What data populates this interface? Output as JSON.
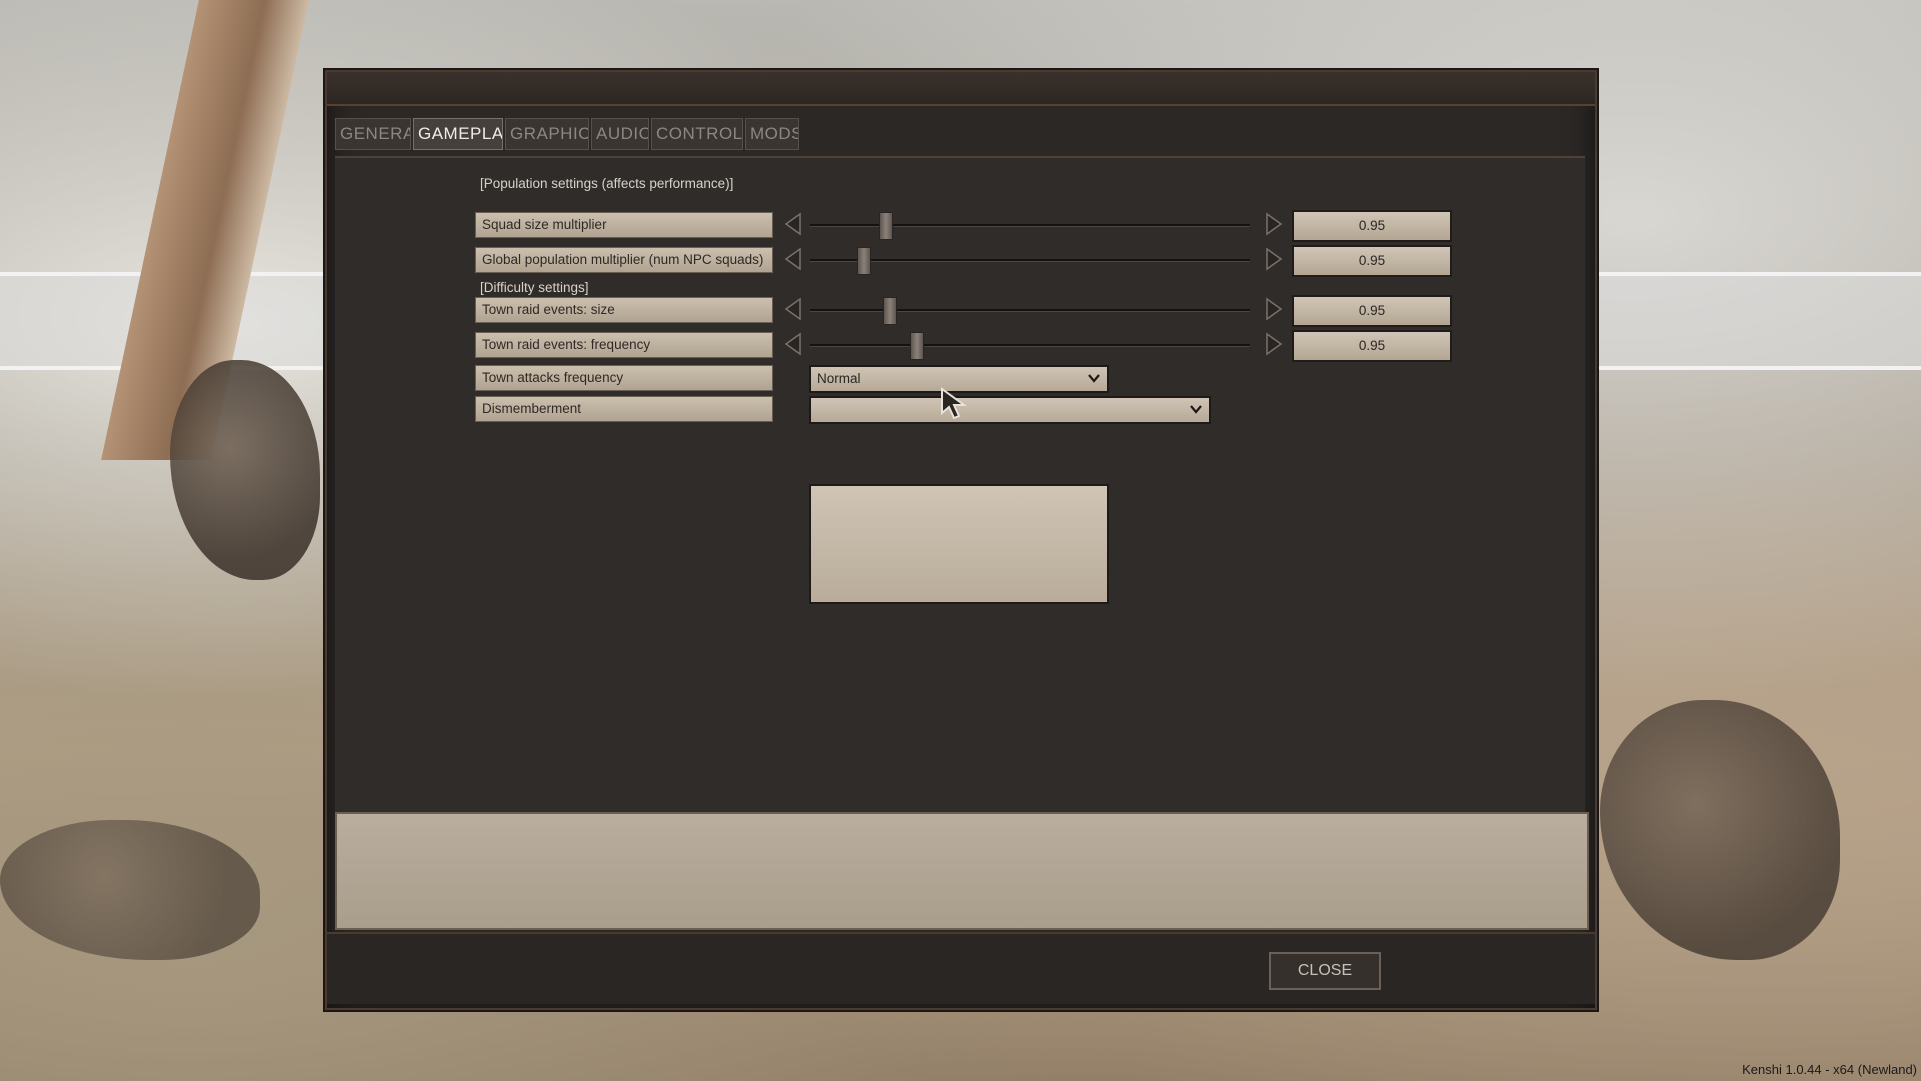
{
  "tabs": [
    {
      "label": "GENERAL",
      "active": false
    },
    {
      "label": "GAMEPLAY",
      "active": true
    },
    {
      "label": "GRAPHICS",
      "active": false
    },
    {
      "label": "AUDIO",
      "active": false
    },
    {
      "label": "CONTROLS",
      "active": false
    },
    {
      "label": "MODS",
      "active": false
    }
  ],
  "sections": {
    "population": "[Population settings (affects performance)]",
    "difficulty": "[Difficulty settings]"
  },
  "settings": {
    "squad_size": {
      "label": "Squad size multiplier",
      "value": "0.95",
      "slider_fraction": 0.17
    },
    "global_population": {
      "label": "Global population multiplier (num NPC squads)",
      "value": "0.95",
      "slider_fraction": 0.12
    },
    "raid_size": {
      "label": "Town raid events: size",
      "value": "0.95",
      "slider_fraction": 0.18
    },
    "raid_frequency": {
      "label": "Town raid events: frequency",
      "value": "0.95",
      "slider_fraction": 0.24
    },
    "attacks_frequency": {
      "label": "Town attacks frequency",
      "selected": "Normal"
    },
    "dismemberment": {
      "label": "Dismemberment",
      "selected": ""
    }
  },
  "close_button": {
    "label": "CLOSE"
  },
  "version_text": "Kenshi 1.0.44 - x64 (Newland)",
  "colors": {
    "panel": "#2b2826",
    "input": "#cfc4b5",
    "accent_border": "#5a4030"
  }
}
